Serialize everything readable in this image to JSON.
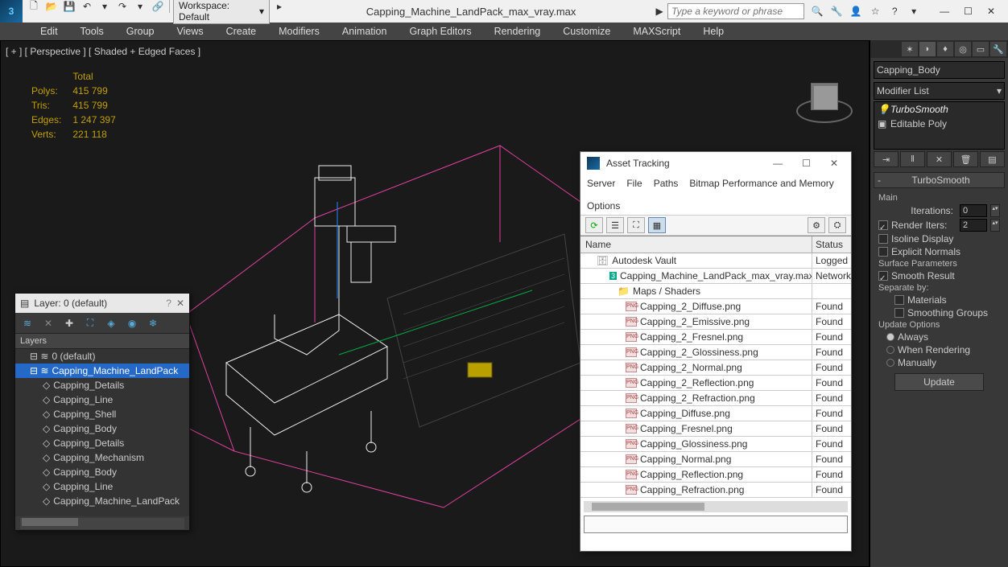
{
  "title": "Capping_Machine_LandPack_max_vray.max",
  "workspace_label": "Workspace: Default",
  "search_placeholder": "Type a keyword or phrase",
  "menu": [
    "Edit",
    "Tools",
    "Group",
    "Views",
    "Create",
    "Modifiers",
    "Animation",
    "Graph Editors",
    "Rendering",
    "Customize",
    "MAXScript",
    "Help"
  ],
  "viewport_label": "[ + ] [ Perspective ] [ Shaded + Edged Faces ]",
  "stats": {
    "total": "Total",
    "polys_label": "Polys:",
    "polys": "415 799",
    "tris_label": "Tris:",
    "tris": "415 799",
    "edges_label": "Edges:",
    "edges": "1 247 397",
    "verts_label": "Verts:",
    "verts": "221 118"
  },
  "rightpanel": {
    "objname": "Capping_Body",
    "modlist": "Modifier List",
    "stack": [
      "TurboSmooth",
      "Editable Poly"
    ],
    "rollout_title": "TurboSmooth",
    "main": "Main",
    "iterations_label": "Iterations:",
    "iterations": "0",
    "render_iters_label": "Render Iters:",
    "render_iters": "2",
    "isoline": "Isoline Display",
    "explicit": "Explicit Normals",
    "surface_params": "Surface Parameters",
    "smooth_result": "Smooth Result",
    "separate_by": "Separate by:",
    "materials": "Materials",
    "smoothing_groups": "Smoothing Groups",
    "update_options": "Update Options",
    "always": "Always",
    "when_rendering": "When Rendering",
    "manually": "Manually",
    "update_btn": "Update"
  },
  "layerpanel": {
    "title": "Layer: 0 (default)",
    "header": "Layers",
    "tree": [
      {
        "t": "0 (default)",
        "d": 0,
        "sel": false
      },
      {
        "t": "Capping_Machine_LandPack",
        "d": 0,
        "sel": true
      },
      {
        "t": "Capping_Details",
        "d": 1
      },
      {
        "t": "Capping_Line",
        "d": 1
      },
      {
        "t": "Capping_Shell",
        "d": 1
      },
      {
        "t": "Capping_Body",
        "d": 1
      },
      {
        "t": "Capping_Details",
        "d": 1
      },
      {
        "t": "Capping_Mechanism",
        "d": 1
      },
      {
        "t": "Capping_Body",
        "d": 1
      },
      {
        "t": "Capping_Line",
        "d": 1
      },
      {
        "t": "Capping_Machine_LandPack",
        "d": 1
      }
    ]
  },
  "assetpanel": {
    "title": "Asset Tracking",
    "menu": [
      "Server",
      "File",
      "Paths",
      "Bitmap Performance and Memory",
      "Options"
    ],
    "col_name": "Name",
    "col_status": "Status",
    "rows": [
      {
        "pad": 20,
        "icon": "vault",
        "name": "Autodesk Vault",
        "status": "Logged"
      },
      {
        "pad": 36,
        "icon": "max",
        "name": "Capping_Machine_LandPack_max_vray.max",
        "status": "Network"
      },
      {
        "pad": 46,
        "icon": "folder",
        "name": "Maps / Shaders",
        "status": ""
      },
      {
        "pad": 56,
        "icon": "png",
        "name": "Capping_2_Diffuse.png",
        "status": "Found"
      },
      {
        "pad": 56,
        "icon": "png",
        "name": "Capping_2_Emissive.png",
        "status": "Found"
      },
      {
        "pad": 56,
        "icon": "png",
        "name": "Capping_2_Fresnel.png",
        "status": "Found"
      },
      {
        "pad": 56,
        "icon": "png",
        "name": "Capping_2_Glossiness.png",
        "status": "Found"
      },
      {
        "pad": 56,
        "icon": "png",
        "name": "Capping_2_Normal.png",
        "status": "Found"
      },
      {
        "pad": 56,
        "icon": "png",
        "name": "Capping_2_Reflection.png",
        "status": "Found"
      },
      {
        "pad": 56,
        "icon": "png",
        "name": "Capping_2_Refraction.png",
        "status": "Found"
      },
      {
        "pad": 56,
        "icon": "png",
        "name": "Capping_Diffuse.png",
        "status": "Found"
      },
      {
        "pad": 56,
        "icon": "png",
        "name": "Capping_Fresnel.png",
        "status": "Found"
      },
      {
        "pad": 56,
        "icon": "png",
        "name": "Capping_Glossiness.png",
        "status": "Found"
      },
      {
        "pad": 56,
        "icon": "png",
        "name": "Capping_Normal.png",
        "status": "Found"
      },
      {
        "pad": 56,
        "icon": "png",
        "name": "Capping_Reflection.png",
        "status": "Found"
      },
      {
        "pad": 56,
        "icon": "png",
        "name": "Capping_Refraction.png",
        "status": "Found"
      }
    ]
  }
}
